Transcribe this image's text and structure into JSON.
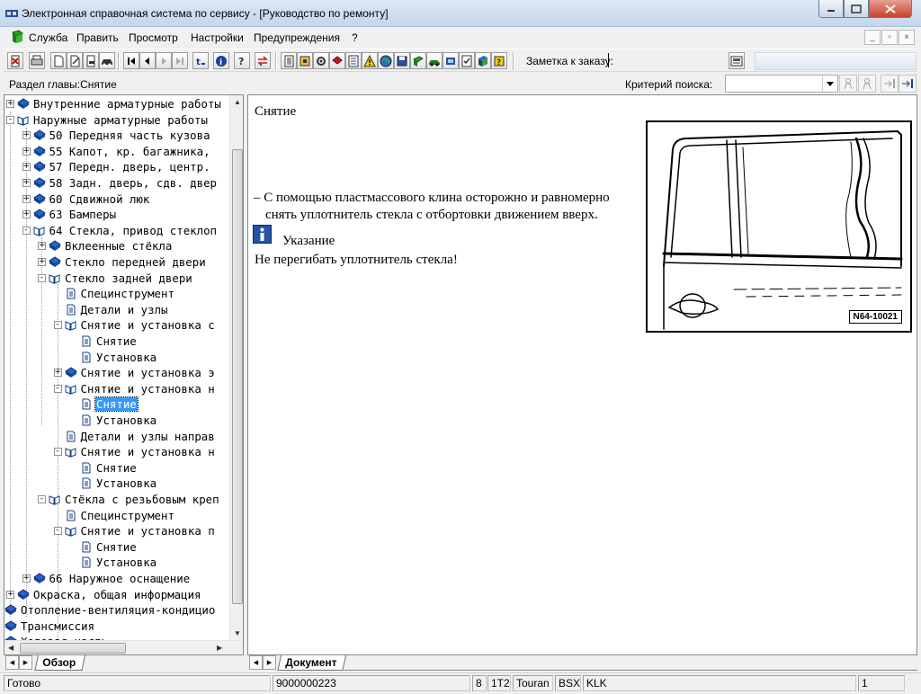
{
  "window": {
    "title": "Электронная справочная система по сервису - [Руководство по ремонту]"
  },
  "menu": {
    "items": [
      {
        "label": "Служба"
      },
      {
        "label": "Править"
      },
      {
        "label": "Просмотр"
      },
      {
        "label": "Настройки"
      },
      {
        "label": "Предупреждения"
      },
      {
        "label": "?"
      }
    ]
  },
  "toolbar": {
    "note_label": "Заметка к заказу:"
  },
  "section": {
    "label": "Раздел главы:Снятие",
    "criteria_label": "Критерий  поиска:",
    "criteria_value": ""
  },
  "tree": {
    "nodes": [
      {
        "label": "Внутренние арматурные работы",
        "icon": "book-closed-icon"
      },
      {
        "label": "Наружные арматурные работы",
        "icon": "book-open-icon"
      },
      {
        "label": "50 Передняя часть кузова",
        "icon": "book-closed-icon"
      },
      {
        "label": "55 Капот, кр. багажника,",
        "icon": "book-closed-icon"
      },
      {
        "label": "57 Передн. дверь, центр.",
        "icon": "book-closed-icon"
      },
      {
        "label": "58 Задн. дверь, сдв. двер",
        "icon": "book-closed-icon"
      },
      {
        "label": "60 Сдвижной люк",
        "icon": "book-closed-icon"
      },
      {
        "label": "63 Бамперы",
        "icon": "book-closed-icon"
      },
      {
        "label": "64 Стекла, привод стеклоп",
        "icon": "book-open-icon"
      },
      {
        "label": "Вклеенные стёкла",
        "icon": "book-closed-icon"
      },
      {
        "label": "Стекло передней двери",
        "icon": "book-closed-icon"
      },
      {
        "label": "Стекло задней двери",
        "icon": "book-open-icon"
      },
      {
        "label": "Специнструмент",
        "icon": "page-icon"
      },
      {
        "label": "Детали и узлы",
        "icon": "page-icon"
      },
      {
        "label": "Снятие и установка с",
        "icon": "book-open-icon"
      },
      {
        "label": "Снятие",
        "icon": "page-icon"
      },
      {
        "label": "Установка",
        "icon": "page-icon"
      },
      {
        "label": "Снятие и установка э",
        "icon": "book-closed-icon"
      },
      {
        "label": "Снятие и установка н",
        "icon": "book-open-icon"
      },
      {
        "label": "Снятие",
        "icon": "page-icon"
      },
      {
        "label": "Установка",
        "icon": "page-icon"
      },
      {
        "label": "Детали и узлы направ",
        "icon": "page-icon"
      },
      {
        "label": "Снятие и установка н",
        "icon": "book-open-icon"
      },
      {
        "label": "Снятие",
        "icon": "page-icon"
      },
      {
        "label": "Установка",
        "icon": "page-icon"
      },
      {
        "label": "Стёкла с резьбовым креп",
        "icon": "book-open-icon"
      },
      {
        "label": "Специнструмент",
        "icon": "page-icon"
      },
      {
        "label": "Снятие и установка п",
        "icon": "book-open-icon"
      },
      {
        "label": "Снятие",
        "icon": "page-icon"
      },
      {
        "label": "Установка",
        "icon": "page-icon"
      },
      {
        "label": "66 Наружное оснащение",
        "icon": "book-closed-icon"
      },
      {
        "label": "Окраска, общая информация",
        "icon": "book-closed-icon"
      },
      {
        "label": "Отопление-вентиляция-кондицио",
        "icon": "book-closed-icon"
      },
      {
        "label": "Трансмиссия",
        "icon": "book-closed-icon"
      },
      {
        "label": "Ходовая часть",
        "icon": "book-closed-icon"
      }
    ]
  },
  "document": {
    "heading": "Снятие",
    "step_line1": "– С помощью пластмассового клина осторожно и равномерно",
    "step_line2": "снять уплотнитель стекла с отбортовки движением вверх.",
    "note_title": "Указание",
    "note_text": "Не перегибать уплотнитель стекла!",
    "figure_label": "N64-10021"
  },
  "tabs": {
    "left": "Обзор",
    "right": "Документ"
  },
  "status": {
    "ready": "Готово",
    "order": "9000000223",
    "c1": "8",
    "c2": "1T2",
    "c3": "Touran",
    "c4": "BSX",
    "c5": "KLK",
    "page": "1"
  }
}
